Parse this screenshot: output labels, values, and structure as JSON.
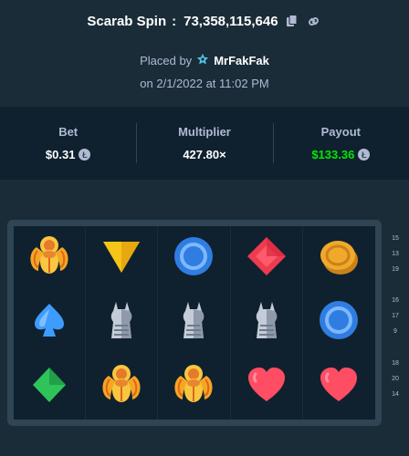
{
  "header": {
    "game_name": "Scarab Spin",
    "bet_id": "73,358,115,646",
    "copy_icon": "copy-icon",
    "link_icon": "link-icon"
  },
  "placed": {
    "prefix": "Placed by",
    "user": "MrFakFak",
    "user_icon": "vip-star-icon",
    "date": "on 2/1/2022 at 11:02 PM"
  },
  "stats": {
    "bet_label": "Bet",
    "bet_value": "$0.31",
    "multiplier_label": "Multiplier",
    "multiplier_value": "427.80×",
    "payout_label": "Payout",
    "payout_value": "$133.36",
    "currency_icon": "litecoin-icon",
    "currency_symbol": "Ł",
    "payout_color": "#00e701"
  },
  "reels": {
    "rows": [
      [
        "scarab",
        "yellow-triangle",
        "blue-circle",
        "red-diamond",
        "gold-coin"
      ],
      [
        "blue-spade",
        "cat-statue",
        "cat-statue",
        "cat-statue",
        "blue-circle"
      ],
      [
        "green-diamond",
        "scarab",
        "scarab",
        "red-heart",
        "red-heart"
      ]
    ]
  },
  "side_numbers": [
    [
      "15",
      "13",
      "19"
    ],
    [
      "16",
      "17",
      "9"
    ],
    [
      "18",
      "20",
      "14"
    ]
  ]
}
